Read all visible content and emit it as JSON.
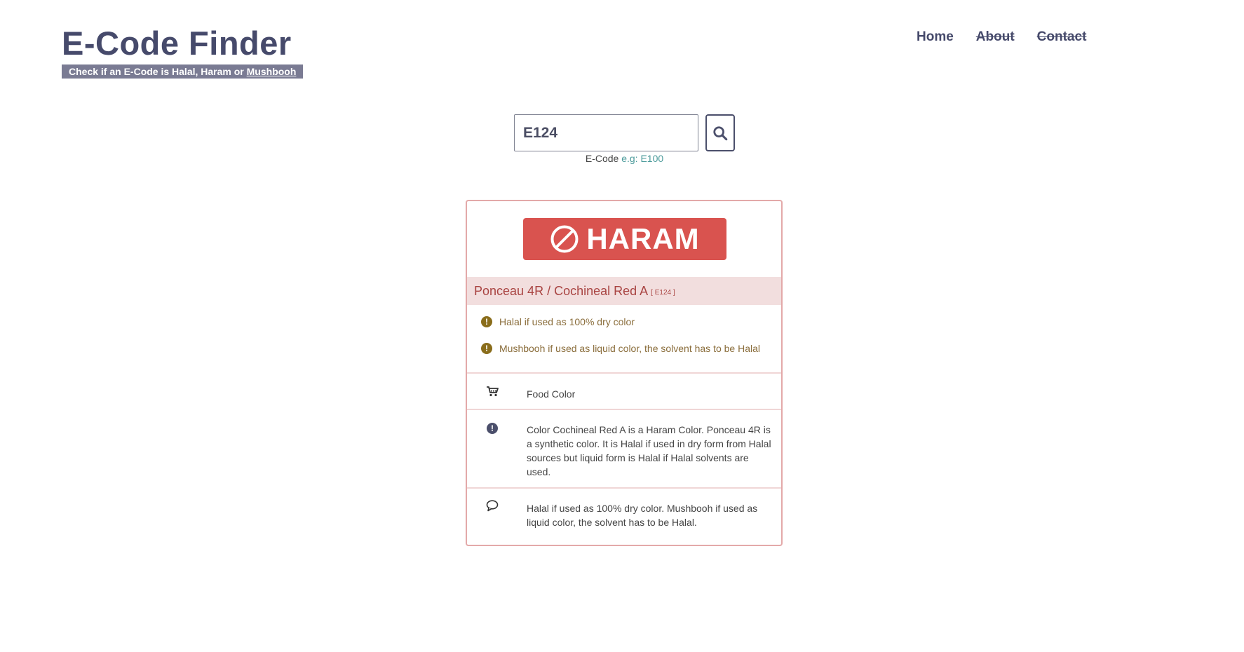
{
  "header": {
    "title": "E-Code Finder",
    "tagline_prefix": "Check if an E-Code is Halal, Haram or ",
    "tagline_link": "Mushbooh"
  },
  "nav": {
    "home": "Home",
    "about": "About",
    "contact": "Contact"
  },
  "search": {
    "value": "E124",
    "help_label": "E-Code",
    "help_example": "e.g: E100"
  },
  "result": {
    "verdict": "HARAM",
    "name": "Ponceau 4R / Cochineal Red A",
    "code_tag": "[ E124 ]",
    "warnings": [
      "Halal if used as 100% dry color",
      "Mushbooh if used as liquid color, the solvent has to be Halal"
    ],
    "category": "Food Color",
    "description": "Color Cochineal Red A is a Haram Color. Ponceau 4R is a synthetic color. It is Halal if used in dry form from Halal sources but liquid form is Halal if Halal solvents are used.",
    "note": "Halal if used as 100% dry color. Mushbooh if used as liquid color, the solvent has to be Halal."
  },
  "colors": {
    "brand": "#464a6b",
    "haram": "#d9534f",
    "name_bar_bg": "#f2dede",
    "name_text": "#a94442",
    "warning_text": "#8a6d3b",
    "example_link": "#4a9a9a"
  },
  "icons": {
    "search": "search-icon",
    "verdict": "ban-icon",
    "warning": "exclamation-circle-icon",
    "category": "cart-icon",
    "description": "info-circle-icon",
    "note": "comment-icon"
  }
}
